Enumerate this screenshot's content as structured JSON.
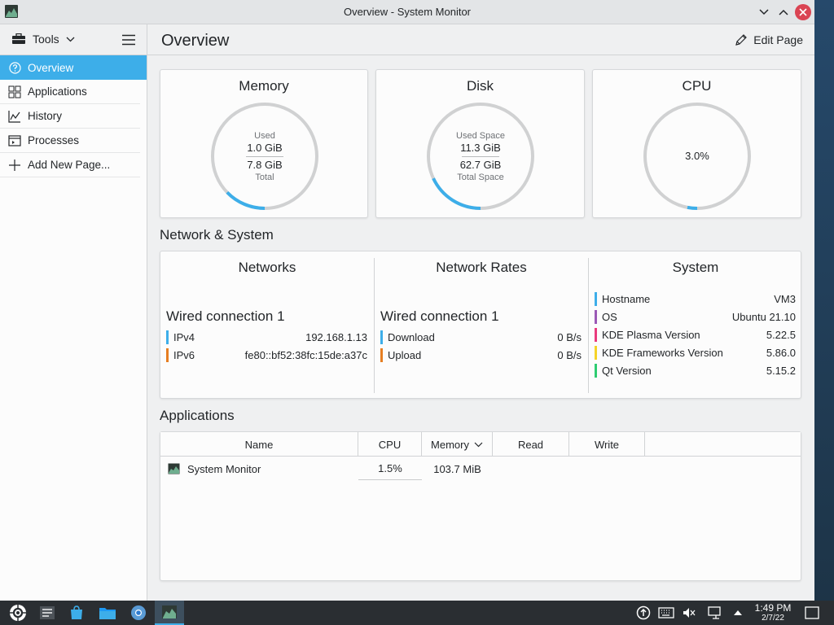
{
  "window": {
    "title": "Overview - System Monitor"
  },
  "sidebar": {
    "tools_label": "Tools",
    "items": [
      {
        "label": "Overview",
        "icon": "help-circle-icon",
        "active": true
      },
      {
        "label": "Applications",
        "icon": "grid-icon"
      },
      {
        "label": "History",
        "icon": "chart-line-icon"
      },
      {
        "label": "Processes",
        "icon": "terminal-window-icon"
      },
      {
        "label": "Add New Page...",
        "icon": "plus-icon"
      }
    ]
  },
  "header": {
    "title": "Overview",
    "edit_label": "Edit Page"
  },
  "memory": {
    "title": "Memory",
    "top_label": "Used",
    "used": "1.0 GiB",
    "total": "7.8 GiB",
    "bottom_label": "Total",
    "fraction": 0.128
  },
  "disk": {
    "title": "Disk",
    "top_label": "Used Space",
    "used": "11.3 GiB",
    "total": "62.7 GiB",
    "bottom_label": "Total Space",
    "fraction": 0.18
  },
  "cpu": {
    "title": "CPU",
    "value": "3.0%",
    "fraction": 0.03
  },
  "sections": {
    "network": "Network & System",
    "applications": "Applications"
  },
  "networks": {
    "title": "Networks",
    "connection": "Wired connection 1",
    "rows": [
      {
        "key": "IPv4",
        "value": "192.168.1.13",
        "color": "#3daee9"
      },
      {
        "key": "IPv6",
        "value": "fe80::bf52:38fc:15de:a37c",
        "color": "#e67e22"
      }
    ]
  },
  "rates": {
    "title": "Network Rates",
    "connection": "Wired connection 1",
    "rows": [
      {
        "key": "Download",
        "value": "0 B/s",
        "color": "#3daee9"
      },
      {
        "key": "Upload",
        "value": "0 B/s",
        "color": "#e67e22"
      }
    ]
  },
  "system": {
    "title": "System",
    "rows": [
      {
        "key": "Hostname",
        "value": "VM3",
        "color": "#3daee9"
      },
      {
        "key": "OS",
        "value": "Ubuntu 21.10",
        "color": "#9b59b6"
      },
      {
        "key": "KDE Plasma Version",
        "value": "5.22.5",
        "color": "#e93a7d"
      },
      {
        "key": "KDE Frameworks Version",
        "value": "5.86.0",
        "color": "#f5d327"
      },
      {
        "key": "Qt Version",
        "value": "5.15.2",
        "color": "#2ecc71"
      }
    ]
  },
  "apps_table": {
    "columns": [
      "Name",
      "CPU",
      "Memory",
      "Read",
      "Write"
    ],
    "rows": [
      {
        "name": "System Monitor",
        "cpu": "1.5%",
        "memory": "103.7 MiB",
        "read": "",
        "write": ""
      }
    ]
  },
  "taskbar": {
    "time": "1:49 PM",
    "date": "2/7/22",
    "apps": [
      "app-launcher-icon",
      "task-manager-icon",
      "discover-store-icon",
      "dolphin-folder-icon",
      "chromium-browser-icon",
      "system-monitor-icon"
    ],
    "tray": [
      "updates-icon",
      "keyboard-icon",
      "volume-muted-icon",
      "network-wired-icon",
      "tray-expand-icon",
      "show-desktop-icon"
    ]
  },
  "colors": {
    "accent": "#3daee9",
    "gauge_track": "#d0d1d2",
    "close": "#da4453"
  }
}
